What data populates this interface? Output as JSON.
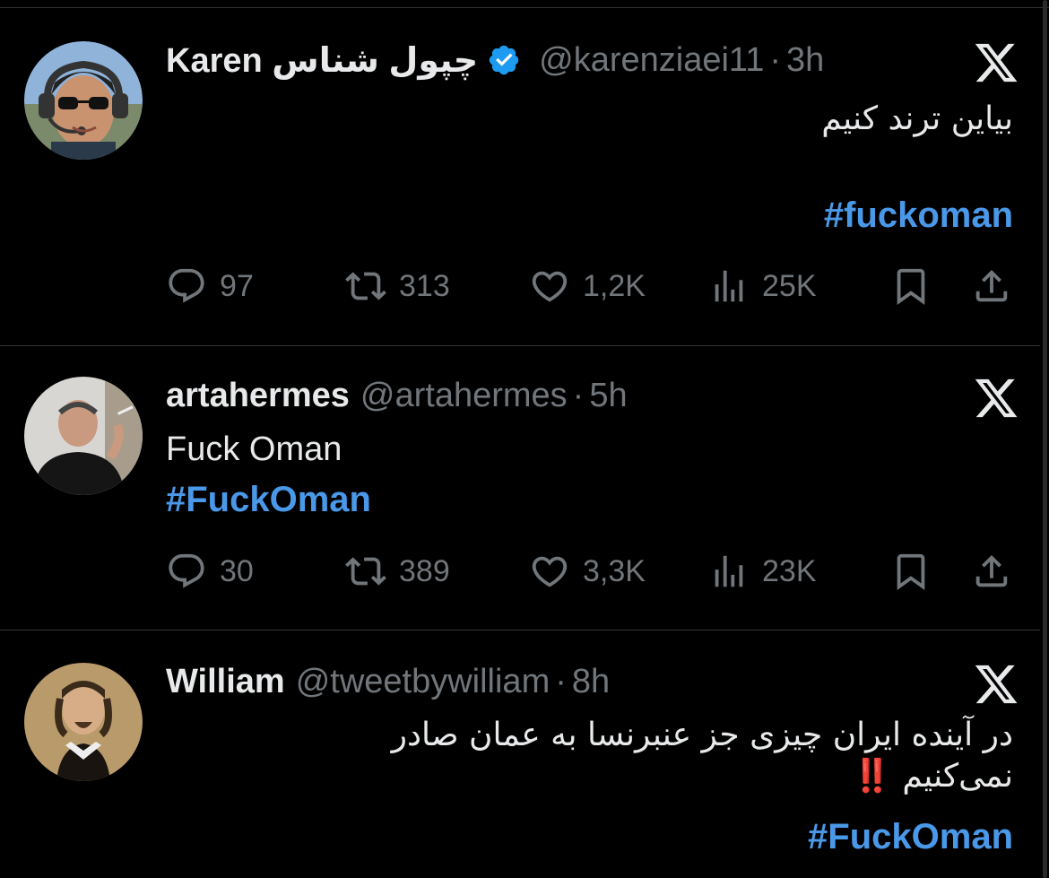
{
  "tweets": [
    {
      "name": "Karen چپول شناس",
      "verified": true,
      "handle": "@karenziaei11",
      "time": "3h",
      "text_lines": [
        "بیاین ترند کنیم"
      ],
      "hashtag": "#fuckoman",
      "replies": "97",
      "reposts": "313",
      "likes": "1,2K",
      "views": "25K"
    },
    {
      "name": "artahermes",
      "verified": false,
      "handle": "@artahermes",
      "time": "5h",
      "text_lines": [
        "Fuck Oman"
      ],
      "hashtag": "#FuckOman",
      "replies": "30",
      "reposts": "389",
      "likes": "3,3K",
      "views": "23K"
    },
    {
      "name": "William",
      "verified": false,
      "handle": "@tweetbywilliam",
      "time": "8h",
      "text_lines": [
        "در آینده ایران چیزی جز عنبرنسا به عمان صادر",
        "نمی‌کنیم"
      ],
      "emoji": "‼️",
      "hashtag": "#FuckOman"
    }
  ],
  "icons": [
    "reply-icon",
    "repost-icon",
    "like-icon",
    "views-icon",
    "bookmark-icon",
    "share-icon",
    "x-logo-icon",
    "verified-badge-icon"
  ],
  "colors": {
    "background": "#000000",
    "text": "#e7e9ea",
    "muted": "#71767b",
    "link": "#4a99e9",
    "verified": "#1d9bf0"
  }
}
